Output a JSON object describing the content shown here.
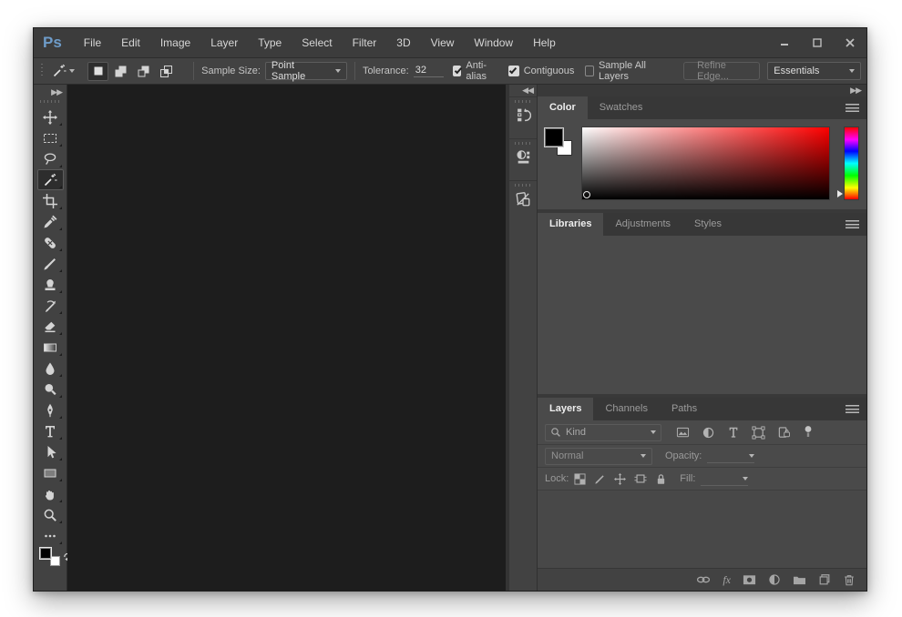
{
  "window": {
    "logo": "Ps"
  },
  "menubar": {
    "items": [
      "File",
      "Edit",
      "Image",
      "Layer",
      "Type",
      "Select",
      "Filter",
      "3D",
      "View",
      "Window",
      "Help"
    ]
  },
  "options_bar": {
    "active_tool": "magic-wand",
    "sample_size_label": "Sample Size:",
    "sample_size_value": "Point Sample",
    "tolerance_label": "Tolerance:",
    "tolerance_value": "32",
    "checkboxes": [
      {
        "label": "Anti-alias",
        "checked": true
      },
      {
        "label": "Contiguous",
        "checked": true
      },
      {
        "label": "Sample All Layers",
        "checked": false
      }
    ],
    "refine_edge_label": "Refine Edge...",
    "workspace_value": "Essentials"
  },
  "toolbar": {
    "tools": [
      "move",
      "rectangular-marquee",
      "lasso",
      "magic-wand",
      "crop",
      "eyedropper",
      "spot-healing-brush",
      "brush",
      "clone-stamp",
      "history-brush",
      "eraser",
      "gradient",
      "blur",
      "dodge",
      "pen",
      "type",
      "path-selection",
      "rectangle-shape",
      "hand",
      "zoom",
      "edit-toolbar-ellipsis"
    ],
    "selected_tool": "magic-wand",
    "foreground_color": "#000000",
    "background_color": "#ffffff"
  },
  "icon_strip": {
    "panels": [
      "history",
      "properties",
      "notes"
    ]
  },
  "panels": {
    "color": {
      "tabs": [
        "Color",
        "Swatches"
      ],
      "active_tab": "Color",
      "foreground_color": "#000000",
      "background_color": "#ffffff",
      "selected_hue": "#ff0000"
    },
    "libraries": {
      "tabs": [
        "Libraries",
        "Adjustments",
        "Styles"
      ],
      "active_tab": "Libraries"
    },
    "layers": {
      "tabs": [
        "Layers",
        "Channels",
        "Paths"
      ],
      "active_tab": "Layers",
      "filter_kind_value": "Kind",
      "filter_icons": [
        "pixel-layers",
        "adjustment-layers",
        "type-layers",
        "shape-layers",
        "smart-objects",
        "filter-toggle"
      ],
      "blend_mode_value": "Normal",
      "opacity_label": "Opacity:",
      "lock_label": "Lock:",
      "lock_icons": [
        "lock-transparent-pixels",
        "lock-image-pixels",
        "lock-position",
        "lock-artboard",
        "lock-all"
      ],
      "fill_label": "Fill:",
      "fx_label": "fx",
      "bottom_icons": [
        "link-layers",
        "layer-effects",
        "add-layer-mask",
        "new-adjustment-layer",
        "new-group",
        "new-layer",
        "delete-layer"
      ]
    }
  },
  "colors": {
    "chrome": "#3e3e3e",
    "panel": "#4a4a4a",
    "canvas": "#1d1d1d",
    "logo_blue": "#6e9cc9"
  }
}
